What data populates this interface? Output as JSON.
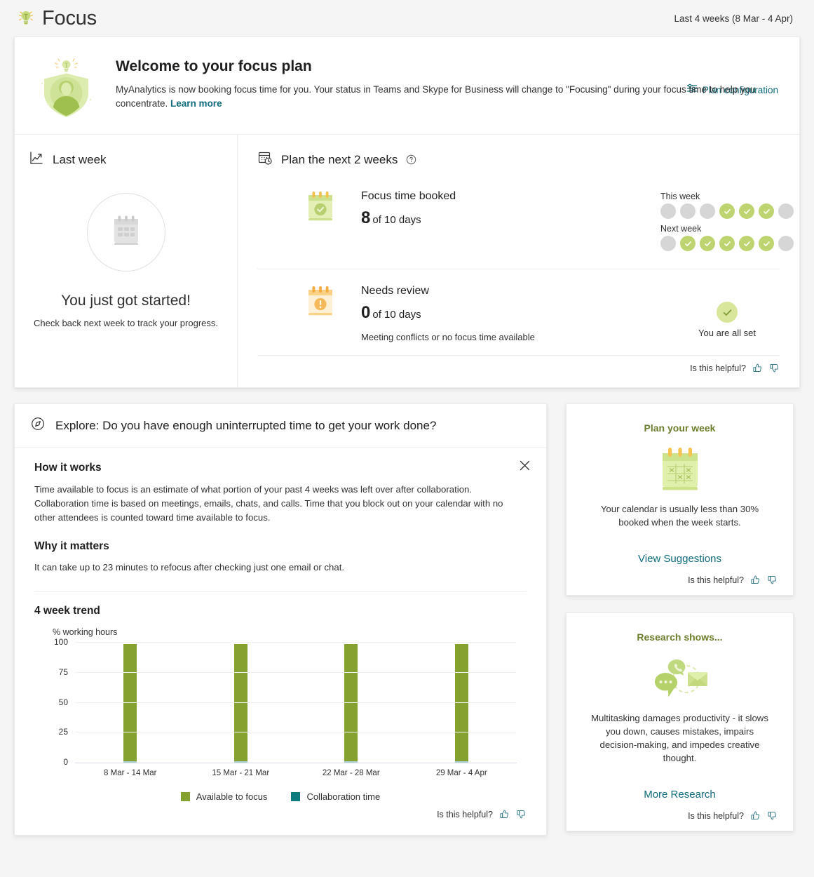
{
  "header": {
    "title": "Focus",
    "icon": "lightbulb-icon",
    "date_range": "Last 4 weeks (8 Mar - 4 Apr)"
  },
  "welcome": {
    "icon": "focus-shield-illustration",
    "title": "Welcome to your focus plan",
    "body_before_link": "MyAnalytics is now booking focus time for you. Your status in Teams and Skype for Business will change to \"Focusing\" during your focus time to help you concentrate. ",
    "learn_more": "Learn more",
    "plan_configuration": "Plan configuration",
    "plan_configuration_icon": "settings-sliders-icon"
  },
  "last_week": {
    "heading": "Last week",
    "heading_icon": "trend-chart-icon",
    "empty_icon": "calendar-icon",
    "empty_title": "You just got started!",
    "empty_sub": "Check back next week to track your progress."
  },
  "plan": {
    "heading": "Plan the next 2 weeks",
    "heading_icon": "calendar-clock-icon",
    "help_icon": "help-circle-icon",
    "rows": [
      {
        "icon": "calendar-check-icon",
        "label": "Focus time booked",
        "value": "8",
        "value_suffix": "of 10 days",
        "note": ""
      },
      {
        "icon": "calendar-alert-icon",
        "label": "Needs review",
        "value": "0",
        "value_suffix": "of 10 days",
        "note": "Meeting conflicts or no focus time available"
      }
    ],
    "this_week_label": "This week",
    "next_week_label": "Next week",
    "this_week_days": [
      false,
      false,
      false,
      true,
      true,
      true,
      false
    ],
    "next_week_days": [
      false,
      true,
      true,
      true,
      true,
      true,
      false
    ],
    "all_set_text": "You are all set",
    "all_set_icon": "check-circle-icon"
  },
  "explore": {
    "heading": "Explore: Do you have enough uninterrupted time to get your work done?",
    "heading_icon": "compass-icon",
    "close_icon": "close-icon",
    "how_it_works_title": "How it works",
    "how_it_works_text": "Time available to focus is an estimate of what portion of your past 4 weeks was left over after collaboration. Collaboration time is based on meetings, emails, chats, and calls. Time that you block out on your calendar with no other attendees is counted toward time available to focus.",
    "why_it_matters_title": "Why it matters",
    "why_it_matters_text": "It can take up to 23 minutes to refocus after checking just one email or chat.",
    "trend_title": "4 week trend"
  },
  "chart_data": {
    "type": "bar",
    "title": "4 week trend",
    "xlabel": "",
    "ylabel": "% working hours",
    "ylim": [
      0,
      100
    ],
    "yticks": [
      0,
      25,
      50,
      75,
      100
    ],
    "grid": true,
    "stacked": true,
    "legend_position": "bottom",
    "categories": [
      "8 Mar - 14 Mar",
      "15 Mar - 21 Mar",
      "22 Mar - 28 Mar",
      "29 Mar - 4 Apr"
    ],
    "series": [
      {
        "name": "Available to focus",
        "color": "#85a231",
        "values": [
          98,
          98,
          98,
          98
        ]
      },
      {
        "name": "Collaboration time",
        "color": "#0e7b7f",
        "values": [
          1,
          1,
          1,
          1
        ]
      }
    ]
  },
  "rail": [
    {
      "title": "Plan your week",
      "art_icon": "calendar-plan-illustration",
      "text": "Your calendar is usually less than 30% booked when the week starts.",
      "link": "View Suggestions"
    },
    {
      "title": "Research shows...",
      "art_icon": "communication-bubbles-illustration",
      "text": "Multitasking damages productivity - it slows you down, causes mistakes, impairs decision-making, and impedes creative thought.",
      "link": "More Research"
    }
  ],
  "feedback": {
    "label": "Is this helpful?",
    "thumbs_up_icon": "thumbs-up-icon",
    "thumbs_down_icon": "thumbs-down-icon"
  },
  "colors": {
    "accent_link": "#0f6b7b",
    "focus_green": "#85a231",
    "collab_teal": "#0e7b7f",
    "rail_title_green": "#6b7f2e",
    "dot_done": "#bdd470",
    "dot_empty": "#d6d6d6"
  }
}
